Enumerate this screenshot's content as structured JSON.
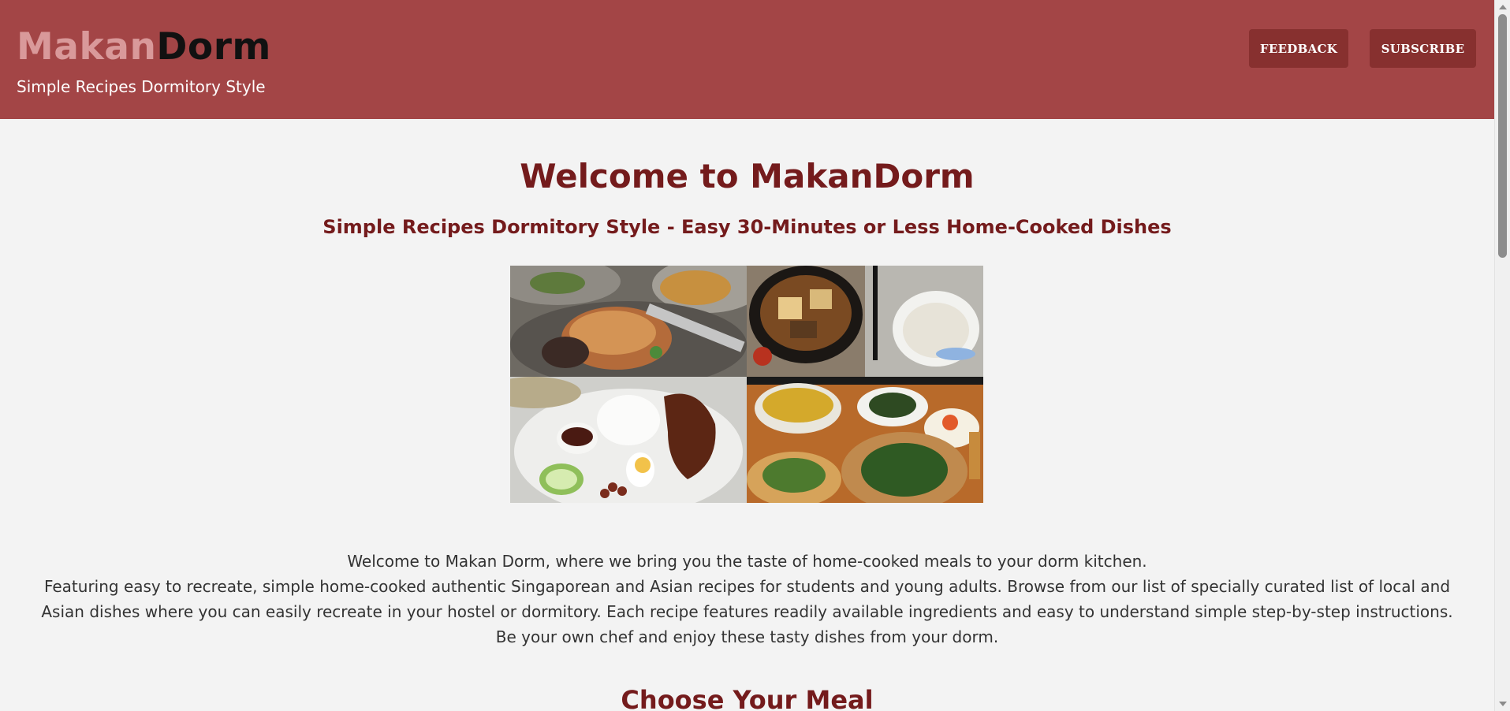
{
  "header": {
    "brand_part1": "Makan",
    "brand_part2": "Dorm",
    "tagline": "Simple Recipes Dormitory Style",
    "feedback_label": "FEEDBACK",
    "subscribe_label": "SUBSCRIBE"
  },
  "main": {
    "title": "Welcome to MakanDorm",
    "subtitle": "Simple Recipes Dormitory Style - Easy 30-Minutes or Less Home-Cooked Dishes",
    "intro": [
      "Welcome to Makan Dorm, where we bring you the taste of home-cooked meals to your dorm kitchen.",
      "Featuring easy to recreate, simple home-cooked authentic Singaporean and Asian recipes for students and young adults. Browse from our list of specially curated list of local and Asian dishes where you can easily recreate in your hostel or dormitory. Each recipe features readily available ingredients and easy to understand simple step-by-step instructions. Be your own chef and enjoy these tasty dishes from your dorm."
    ],
    "section_title": "Choose Your Meal"
  },
  "colors": {
    "header_bg": "#a34546",
    "button_bg": "#87302f",
    "heading": "#741b1c",
    "brand_light": "#d9999a",
    "page_bg": "#f3f3f3"
  }
}
